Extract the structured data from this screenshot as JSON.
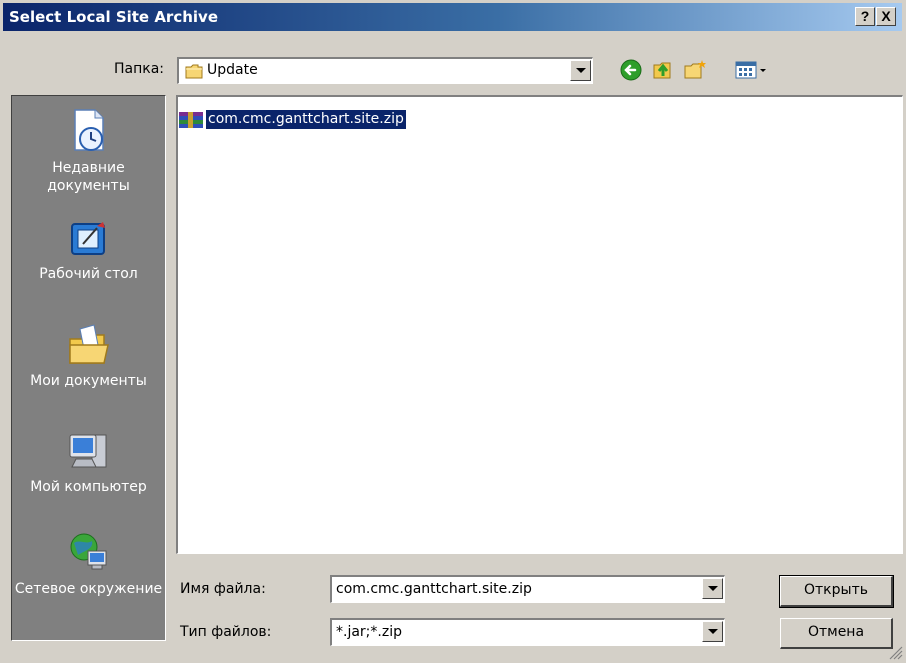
{
  "window": {
    "title": "Select Local Site Archive",
    "help_label": "?",
    "close_label": "X"
  },
  "lookin": {
    "label": "Папка:",
    "value": "Update"
  },
  "toolbar": {
    "icons": [
      "back-icon",
      "up-folder-icon",
      "new-folder-icon",
      "view-menu-icon"
    ]
  },
  "places": [
    {
      "label": "Недавние документы",
      "icon": "recent-documents-icon"
    },
    {
      "label": "Рабочий стол",
      "icon": "desktop-icon"
    },
    {
      "label": "Мои документы",
      "icon": "my-documents-icon"
    },
    {
      "label": "Мой компьютер",
      "icon": "my-computer-icon"
    },
    {
      "label": "Сетевое окружение",
      "icon": "network-icon"
    }
  ],
  "files": [
    {
      "name": "com.cmc.ganttchart.site.zip",
      "icon": "winrar-archive-icon",
      "selected": true
    }
  ],
  "filename": {
    "label": "Имя файла:",
    "value": "com.cmc.ganttchart.site.zip"
  },
  "filetype": {
    "label": "Тип файлов:",
    "value": "*.jar;*.zip"
  },
  "buttons": {
    "open": "Открыть",
    "cancel": "Отмена"
  },
  "colors": {
    "titlebar_start": "#0a246a",
    "titlebar_end": "#a6caf0",
    "face": "#d4d0c8",
    "places_bg": "#808080",
    "selection": "#0a246a"
  }
}
